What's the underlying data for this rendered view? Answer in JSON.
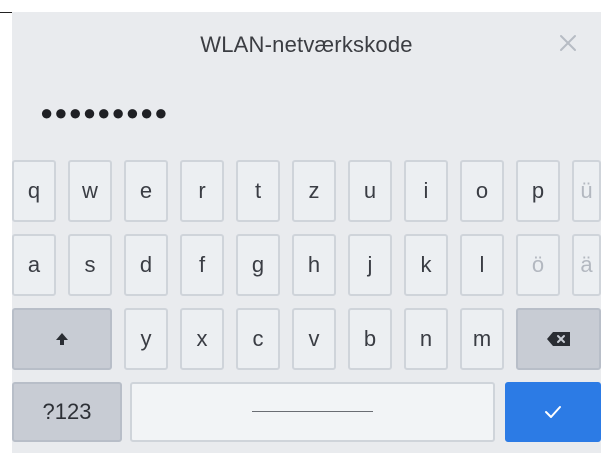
{
  "dialog": {
    "title": "WLAN-netværkskode",
    "close_icon": "close-icon"
  },
  "password": {
    "masked_value": "●●●●●●●●●"
  },
  "keyboard": {
    "row1": [
      "q",
      "w",
      "e",
      "r",
      "t",
      "z",
      "u",
      "i",
      "o",
      "p",
      "ü"
    ],
    "row2": [
      "a",
      "s",
      "d",
      "f",
      "g",
      "h",
      "j",
      "k",
      "l",
      "ö",
      "ä"
    ],
    "row3_letters": [
      "y",
      "x",
      "c",
      "v",
      "b",
      "n",
      "m"
    ],
    "shift_icon": "shift-icon",
    "backspace_icon": "backspace-icon",
    "mode_label": "?123",
    "enter_icon": "checkmark-icon"
  },
  "colors": {
    "accent": "#2c7be5",
    "background": "#e9ebee",
    "key_border": "#cfd4da"
  }
}
